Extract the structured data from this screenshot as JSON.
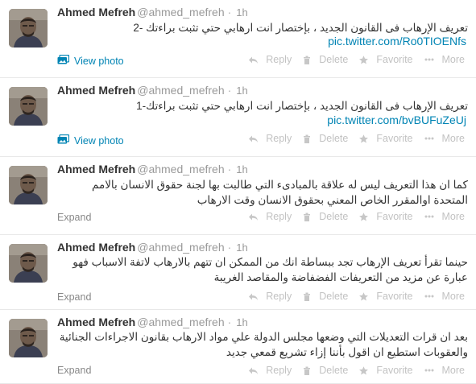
{
  "tweets": [
    {
      "fullname": "Ahmed Mefreh",
      "username": "@ahmed_mefreh",
      "sep": "·",
      "time": "1h",
      "text": "تعريف الإرهاب فى القانون الجديد ، بإختصار انت ارهابي حتي تثبت براءتك -2",
      "link": "pic.twitter.com/Ro0TIOENfs",
      "footer": "View photo",
      "footer_icon": "image-icon"
    },
    {
      "fullname": "Ahmed Mefreh",
      "username": "@ahmed_mefreh",
      "sep": "·",
      "time": "1h",
      "text": "تعريف الإرهاب فى القانون الجديد ، بإختصار انت ارهابي حتي تثبت براءتك-1",
      "link": "pic.twitter.com/bvBUFuZeUj",
      "footer": "View photo",
      "footer_icon": "image-icon"
    },
    {
      "fullname": "Ahmed Mefreh",
      "username": "@ahmed_mefreh",
      "sep": "·",
      "time": "1h",
      "text": "كما ان هذا التعريف ليس له علاقة بالمبادىء التي طالبت بها لجنة حقوق الانسان بالامم المتحدة اوالمقرر الخاص المعني بحقوق الانسان وقت الارهاب",
      "footer": "Expand"
    },
    {
      "fullname": "Ahmed Mefreh",
      "username": "@ahmed_mefreh",
      "sep": "·",
      "time": "1h",
      "text": "حينما تقرأ تعريف الإرهاب تجد ببساطة انك من الممكن ان تتهم بالارهاب لاتفة الاسباب فهو عبارة عن مزيد من التعريفات الفضفاضة والمقاصد الغريبة",
      "footer": "Expand"
    },
    {
      "fullname": "Ahmed Mefreh",
      "username": "@ahmed_mefreh",
      "sep": "·",
      "time": "1h",
      "text": "بعد ان قرات التعديلات التي وضعها مجلس الدولة علي مواد الارهاب بقانون الاجراءات الجنائية والعقوبات استطيع ان اقول بأننا إزاء تشريع قمعي جديد",
      "footer": "Expand"
    }
  ],
  "actions": {
    "reply": "Reply",
    "delete": "Delete",
    "favorite": "Favorite",
    "more": "More"
  },
  "colors": {
    "link": "#0084b4",
    "action": "#c2c2c2",
    "muted": "#999999"
  }
}
